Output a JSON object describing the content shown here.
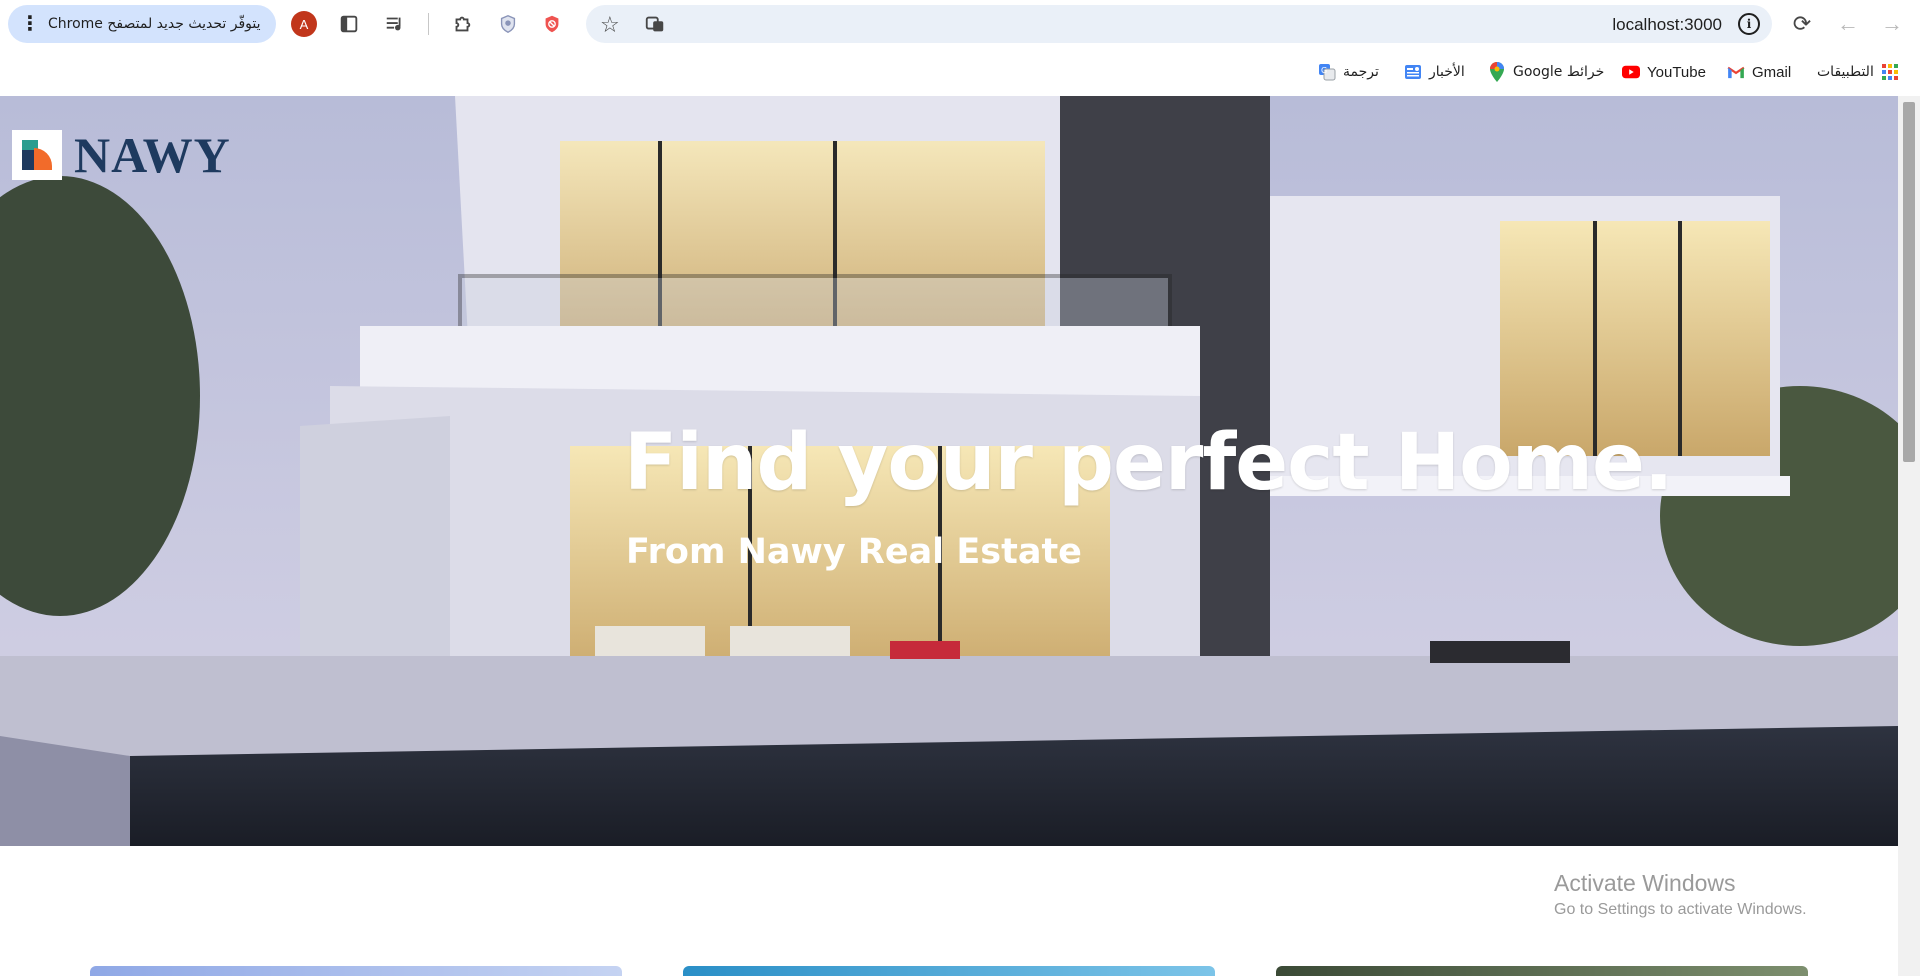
{
  "browser": {
    "update_chip": "يتوفّر تحديث جديد لمتصفح Chrome",
    "avatar_letter": "A",
    "url": "localhost:3000",
    "bookmarks": [
      {
        "label": "التطبيقات",
        "icon": "apps-grid-icon"
      },
      {
        "label": "Gmail",
        "icon": "gmail-icon"
      },
      {
        "label": "YouTube",
        "icon": "youtube-icon"
      },
      {
        "label": "خرائط Google",
        "icon": "maps-icon"
      },
      {
        "label": "الأخبار",
        "icon": "news-icon"
      },
      {
        "label": "ترجمة",
        "icon": "translate-icon"
      }
    ]
  },
  "page": {
    "logo_text": "NAWY",
    "hero_title": "Find your perfect Home.",
    "hero_subtitle": "From Nawy Real Estate"
  },
  "watermark": {
    "line1": "Activate Windows",
    "line2": "Go to Settings to activate Windows."
  },
  "colors": {
    "logo_text": "#1e3a5f",
    "update_chip_bg": "#d3e3fd",
    "omnibox_bg": "#eaf0f8",
    "avatar_bg": "#c1361b"
  }
}
